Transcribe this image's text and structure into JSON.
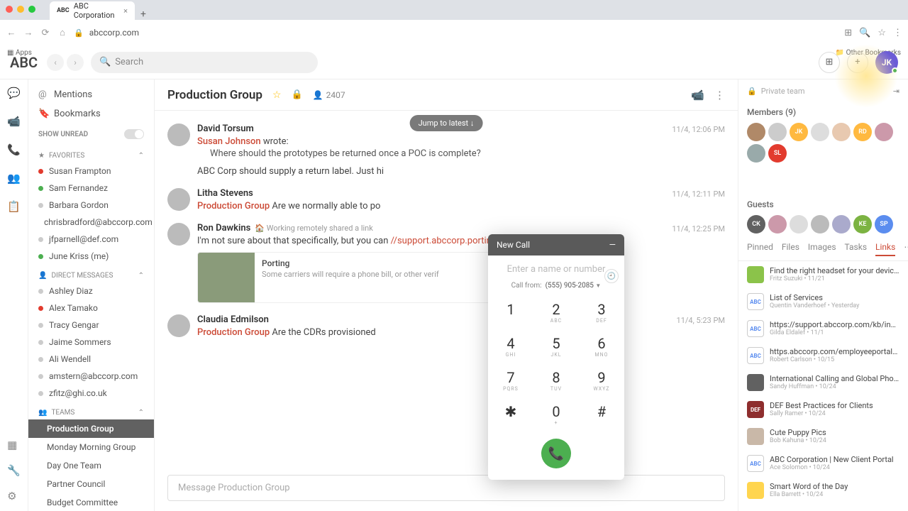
{
  "browser": {
    "tab_title": "ABC Corporation",
    "tab_favicon": "ABC",
    "url": "abccorp.com",
    "apps_label": "Apps",
    "other_bookmarks": "Other Bookmarks"
  },
  "header": {
    "logo": "ABC",
    "search_placeholder": "Search",
    "avatar_initials": "JK"
  },
  "leftnav": {
    "mentions": "Mentions",
    "bookmarks": "Bookmarks",
    "show_unread": "SHOW UNREAD",
    "favorites_label": "FAVORITES",
    "favorites": [
      {
        "name": "Susan Frampton",
        "status": "red"
      },
      {
        "name": "Sam Fernandez",
        "status": "on"
      },
      {
        "name": "Barbara Gordon",
        "status": "off"
      },
      {
        "name": "chrisbradford@abccorp.com",
        "status": "off"
      },
      {
        "name": "jfparnell@def.com",
        "status": "off"
      },
      {
        "name": "June Kriss (me)",
        "status": "on"
      }
    ],
    "dm_label": "DIRECT MESSAGES",
    "dms": [
      {
        "name": "Ashley Diaz",
        "status": "off"
      },
      {
        "name": "Alex Tamako",
        "status": "red"
      },
      {
        "name": "Tracy Gengar",
        "status": "off"
      },
      {
        "name": "Jaime Sommers",
        "status": "off"
      },
      {
        "name": "Ali Wendell",
        "status": "off"
      },
      {
        "name": "amstern@abccorp.com",
        "status": "off"
      },
      {
        "name": "zfitz@ghi.co.uk",
        "status": "off"
      }
    ],
    "teams_label": "TEAMS",
    "teams": [
      {
        "name": "Production Group",
        "active": true
      },
      {
        "name": "Monday Morning Group"
      },
      {
        "name": "Day One Team"
      },
      {
        "name": "Partner Council"
      },
      {
        "name": "Budget Committee"
      }
    ]
  },
  "chat": {
    "title": "Production Group",
    "member_count": "2407",
    "jump_label": "Jump to latest",
    "composer_placeholder": "Message Production Group",
    "messages": [
      {
        "author": "David Torsum",
        "time": "11/4, 12:06 PM",
        "quote_author": "Susan Johnson",
        "quote_suffix": " wrote:",
        "quote_body": "Where should the prototypes be returned once a POC is complete?",
        "body": "ABC Corp should supply a return label. Just hi"
      },
      {
        "author": "Litha Stevens",
        "time": "11/4, 12:11 PM",
        "group": "Production Group",
        "body": "  Are we normally able to po"
      },
      {
        "author": "Ron Dawkins",
        "time": "11/4, 12:25 PM",
        "share_prefix": "🏠 Working remotely",
        "share_suffix": " shared a link",
        "body_pre": "I'm not sure about that specifically, but you can",
        "body_link": "//support.abccorp.porting.html",
        "card_title": "Porting",
        "card_desc": "Some carriers will require a phone bill, or other verif"
      },
      {
        "author": "Claudia Edmilson",
        "time": "11/4, 5:23 PM",
        "group": "Production Group",
        "body": "  Are the CDRs provisioned "
      }
    ]
  },
  "dialer": {
    "title": "New Call",
    "placeholder": "Enter a name or number",
    "from_label": "Call from:",
    "from_number": "(555) 905-2085",
    "keys": [
      {
        "d": "1",
        "l": ""
      },
      {
        "d": "2",
        "l": "ABC"
      },
      {
        "d": "3",
        "l": "DEF"
      },
      {
        "d": "4",
        "l": "GHI"
      },
      {
        "d": "5",
        "l": "JKL"
      },
      {
        "d": "6",
        "l": "MNO"
      },
      {
        "d": "7",
        "l": "PQRS"
      },
      {
        "d": "8",
        "l": "TUV"
      },
      {
        "d": "9",
        "l": "WXYZ"
      },
      {
        "d": "✱",
        "l": ""
      },
      {
        "d": "0",
        "l": "+"
      },
      {
        "d": "#",
        "l": ""
      }
    ]
  },
  "rpanel": {
    "private_label": "Private team",
    "members_label": "Members (9)",
    "member_avatars": [
      {
        "bg": "#b08968",
        "t": ""
      },
      {
        "bg": "#ccc",
        "t": ""
      },
      {
        "bg": "#ffb940",
        "t": "JK"
      },
      {
        "bg": "#ddd",
        "t": ""
      },
      {
        "bg": "#e8c9b0",
        "t": ""
      },
      {
        "bg": "#ffb940",
        "t": "RD"
      },
      {
        "bg": "#c9a",
        "t": ""
      },
      {
        "bg": "#9aa",
        "t": ""
      },
      {
        "bg": "#e23b2e",
        "t": "SL"
      }
    ],
    "guests_label": "Guests",
    "guest_avatars": [
      {
        "bg": "#616161",
        "t": "CK"
      },
      {
        "bg": "#c9a",
        "t": ""
      },
      {
        "bg": "#ddd",
        "t": ""
      },
      {
        "bg": "#bbb",
        "t": ""
      },
      {
        "bg": "#aac",
        "t": ""
      },
      {
        "bg": "#7cb342",
        "t": "KE"
      },
      {
        "bg": "#5b8def",
        "t": "SP"
      }
    ],
    "tabs": [
      "Pinned",
      "Files",
      "Images",
      "Tasks",
      "Links"
    ],
    "active_tab": "Links",
    "links": [
      {
        "title": "Find the right headset for your device wi...",
        "meta": "Fritz Suzuki • 11/21",
        "thumb": "",
        "bg": "#8bc34a"
      },
      {
        "title": "List of Services",
        "meta": "Quentin Vanderhoef • Yesterday",
        "thumb": "ABC",
        "bg": "#fff",
        "bd": true
      },
      {
        "title": "https://support.abccorp.com/kb/index...",
        "meta": "Gilda Eldalef • 11/1",
        "thumb": "ABC",
        "bg": "#fff",
        "bd": true
      },
      {
        "title": "https.abccorp.com/employeeportal/docs...",
        "meta": "Robert Carlson • 10/15",
        "thumb": "ABC",
        "bg": "#fff",
        "bd": true
      },
      {
        "title": "International Calling and Global Phone...",
        "meta": "Sandy Huffman • 10/24",
        "thumb": "",
        "bg": "#616161"
      },
      {
        "title": "DEF Best Practices for Clients",
        "meta": "Sally Ramer • 10/24",
        "thumb": "DEF",
        "bg": "#8e2e2e"
      },
      {
        "title": "Cute Puppy Pics",
        "meta": "Bob Kahuna • 10/24",
        "thumb": "",
        "bg": "#c9b8a8"
      },
      {
        "title": "ABC Corporation | New Client Portal",
        "meta": "Ace Solomon • 10/24",
        "thumb": "ABC",
        "bg": "#fff",
        "bd": true
      },
      {
        "title": "Smart Word of the Day",
        "meta": "Ella Barrett • 10/24",
        "thumb": "",
        "bg": "#ffd54f"
      }
    ]
  }
}
